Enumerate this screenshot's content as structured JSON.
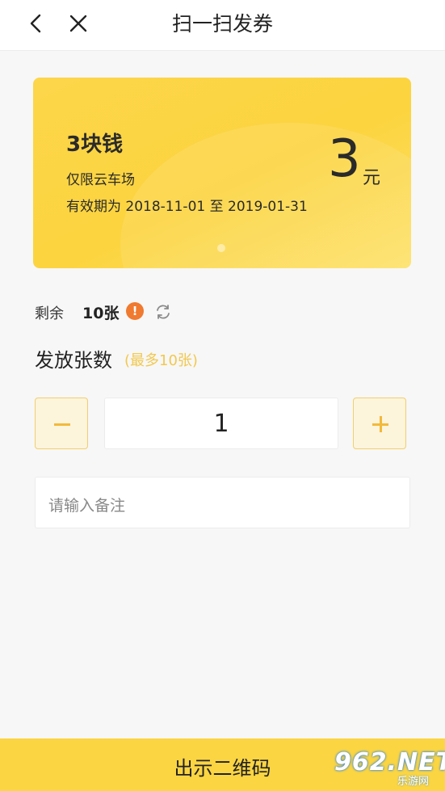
{
  "header": {
    "title": "扫一扫发券",
    "back_icon": "chevron-left-icon",
    "close_icon": "close-icon"
  },
  "coupon": {
    "name": "3块钱",
    "scope": "仅限云车场",
    "validity": "有效期为 2018-11-01 至 2019-01-31",
    "amount": "3",
    "unit": "元"
  },
  "remaining": {
    "label": "剩余",
    "value": "10张",
    "warn_icon": "!",
    "refresh_icon": "refresh-icon"
  },
  "issue": {
    "title": "发放张数",
    "hint": "(最多10张)",
    "quantity": "1"
  },
  "remark": {
    "placeholder": "请输入备注"
  },
  "submit": {
    "label": "出示二维码"
  },
  "watermark": {
    "main": "962.NET",
    "sub": "乐游网"
  },
  "colors": {
    "accent": "#fbd542",
    "coupon_bg": "#fcd43f",
    "hint": "#f2c84e",
    "warn": "#f07a2f"
  }
}
